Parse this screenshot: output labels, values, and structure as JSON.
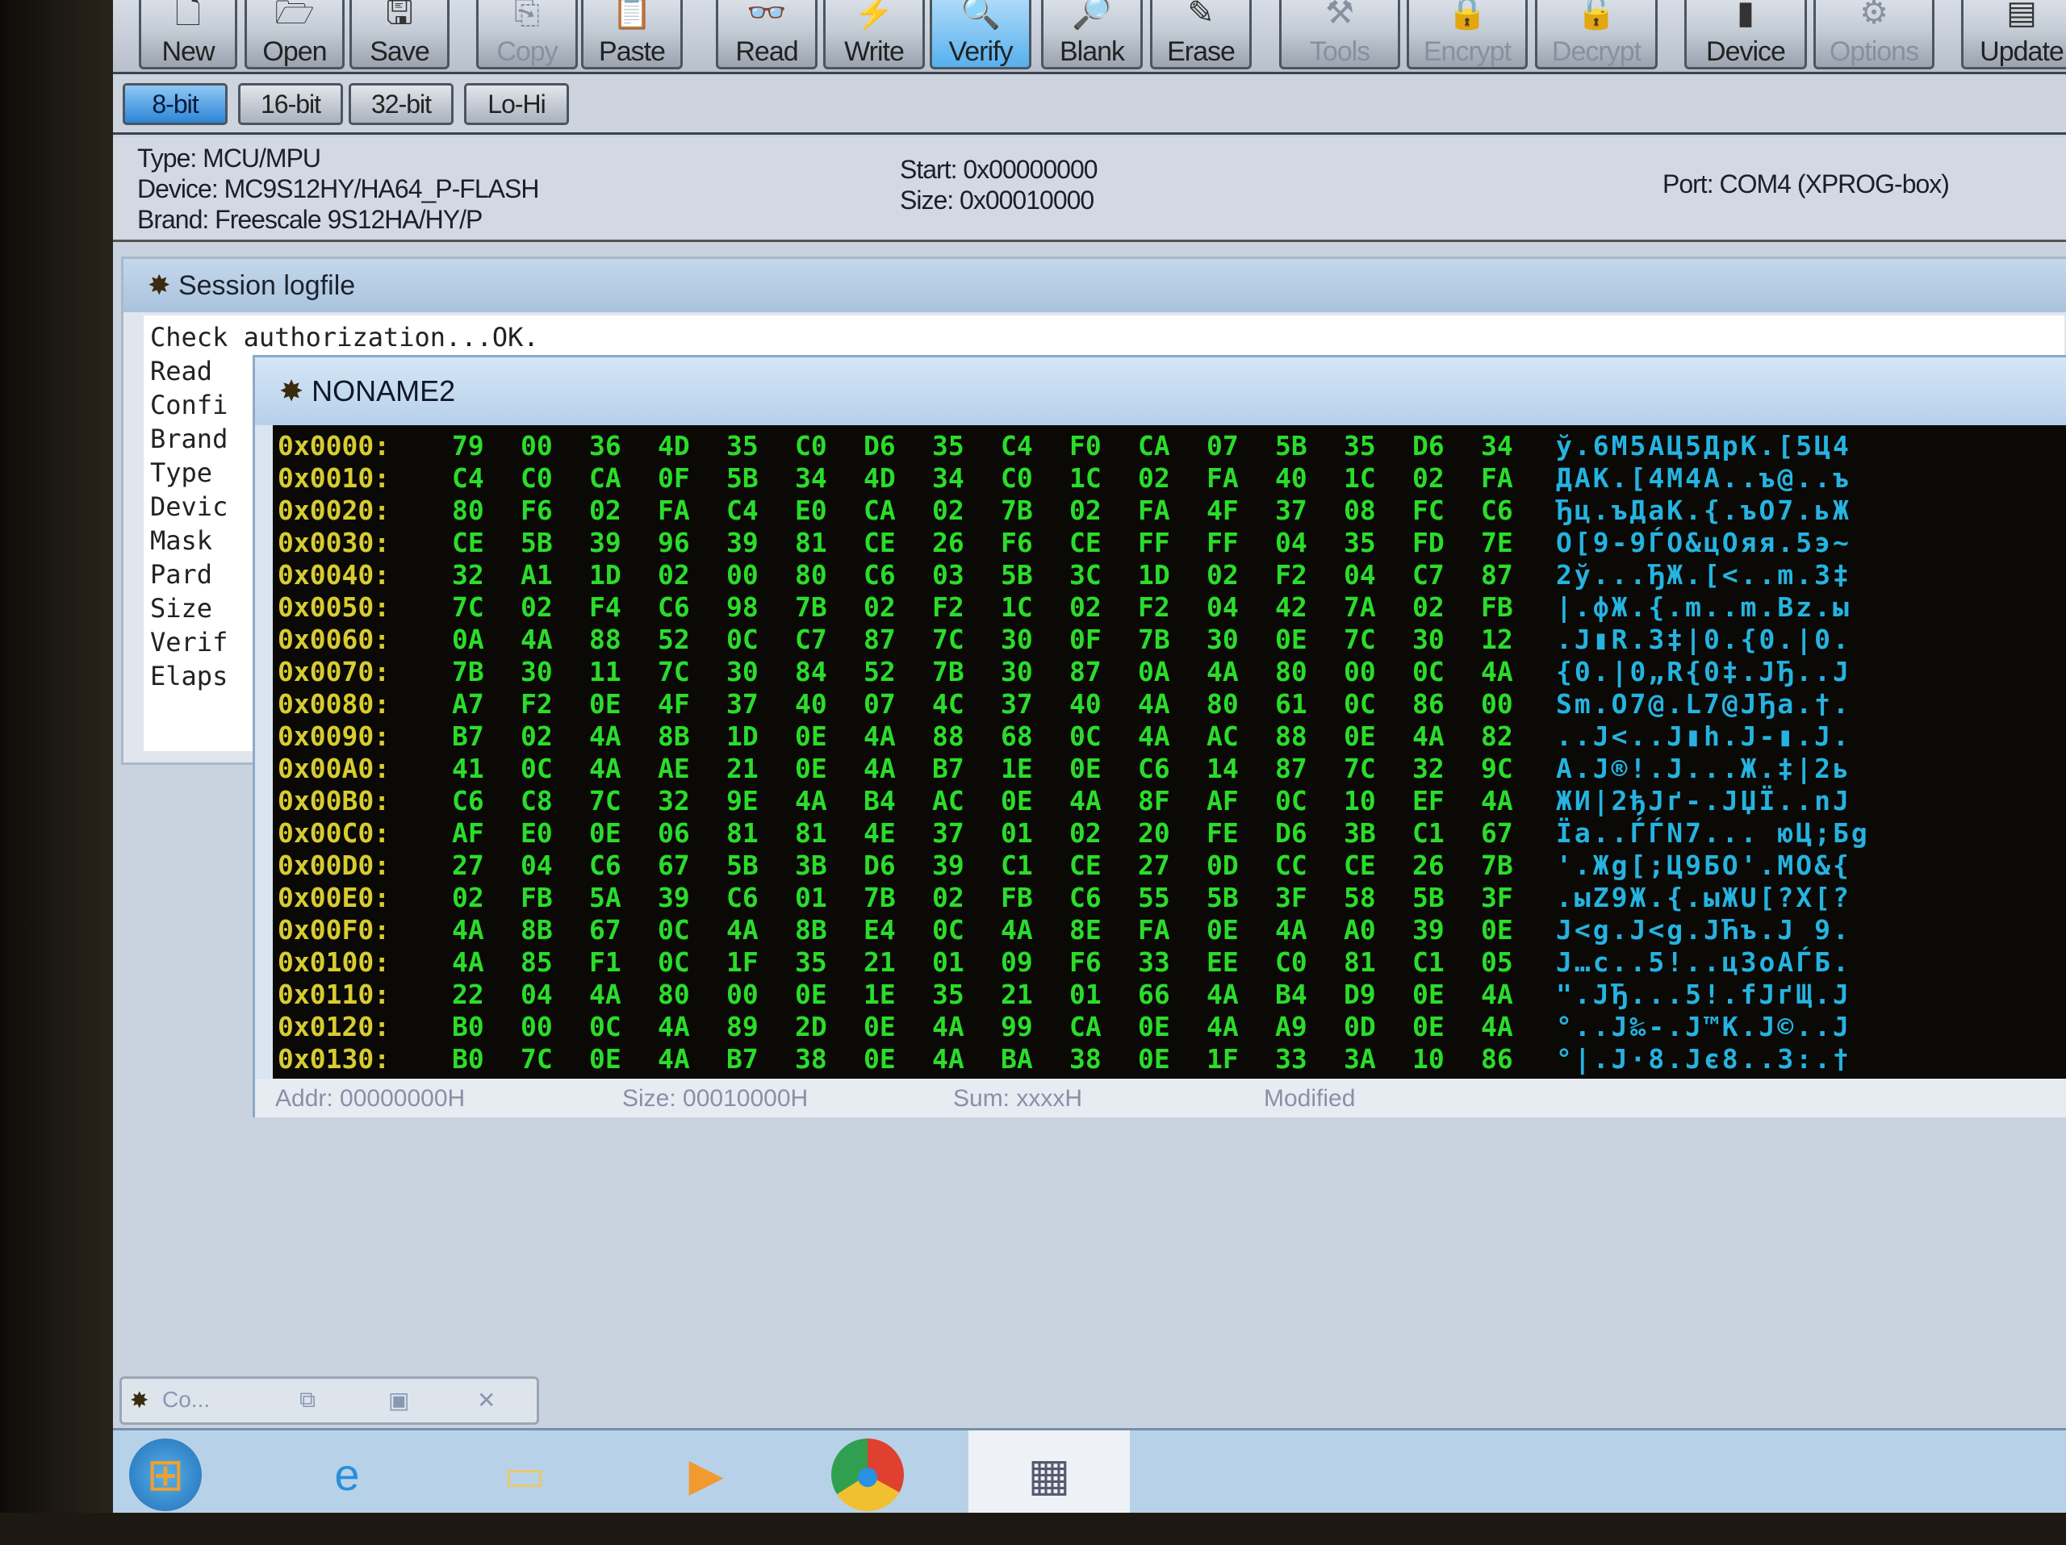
{
  "toolbar": {
    "buttons": [
      {
        "label": "New",
        "icon": "new-file-icon",
        "glyph": "🗋",
        "disabled": false
      },
      {
        "label": "Open",
        "icon": "open-icon",
        "glyph": "🗁",
        "disabled": false
      },
      {
        "label": "Save",
        "icon": "save-icon",
        "glyph": "🖫",
        "disabled": false
      },
      {
        "label": "Copy",
        "icon": "copy-icon",
        "glyph": "⎘",
        "disabled": true
      },
      {
        "label": "Paste",
        "icon": "paste-icon",
        "glyph": "📋",
        "disabled": false
      },
      {
        "label": "Read",
        "icon": "glasses-icon",
        "glyph": "👓",
        "disabled": false
      },
      {
        "label": "Write",
        "icon": "lightning-icon",
        "glyph": "⚡",
        "disabled": false
      },
      {
        "label": "Verify",
        "icon": "magnifier-icon",
        "glyph": "🔍",
        "disabled": false,
        "active": true
      },
      {
        "label": "Blank",
        "icon": "blank-check-icon",
        "glyph": "🔎",
        "disabled": false
      },
      {
        "label": "Erase",
        "icon": "eraser-icon",
        "glyph": "✎",
        "disabled": false
      },
      {
        "label": "Tools",
        "icon": "tools-icon",
        "glyph": "⚒",
        "disabled": true
      },
      {
        "label": "Encrypt",
        "icon": "lock-icon",
        "glyph": "🔒",
        "disabled": true
      },
      {
        "label": "Decrypt",
        "icon": "unlock-icon",
        "glyph": "🔓",
        "disabled": true
      },
      {
        "label": "Device",
        "icon": "chip-icon",
        "glyph": "▮",
        "disabled": false
      },
      {
        "label": "Options",
        "icon": "options-icon",
        "glyph": "⚙",
        "disabled": true
      },
      {
        "label": "Update",
        "icon": "update-icon",
        "glyph": "▤",
        "disabled": false
      }
    ]
  },
  "bitmode": {
    "buttons": [
      "8-bit",
      "16-bit",
      "32-bit",
      "Lo-Hi"
    ],
    "selected": "8-bit"
  },
  "info": {
    "type": "Type: MCU/MPU",
    "device": "Device: MC9S12HY/HA64_P-FLASH",
    "brand": "Brand: Freescale 9S12HA/HY/P",
    "start": "Start: 0x00000000",
    "size": "Size: 0x00010000",
    "port": "Port: COM4 (XPROG-box)"
  },
  "log": {
    "title": "Session logfile",
    "lines": [
      "Check authorization...OK.",
      "Read",
      "Confi",
      "Brand",
      "Type",
      "Devic",
      "Mask",
      "Pard",
      "Size",
      "Verif",
      "Elaps"
    ]
  },
  "hexwin": {
    "title": "NONAME2",
    "rows": [
      {
        "addr": "0x0000:",
        "bytes": [
          "79",
          "00",
          "36",
          "4D",
          "35",
          "C0",
          "D6",
          "35",
          "C4",
          "F0",
          "CA",
          "07",
          "5B",
          "35",
          "D6",
          "34"
        ],
        "ascii": "ў.6M5AЦ5ДрK.[5Ц4"
      },
      {
        "addr": "0x0010:",
        "bytes": [
          "C4",
          "C0",
          "CA",
          "0F",
          "5B",
          "34",
          "4D",
          "34",
          "C0",
          "1C",
          "02",
          "FA",
          "40",
          "1C",
          "02",
          "FA"
        ],
        "ascii": "ДAK.[4M4A..ъ@..ъ"
      },
      {
        "addr": "0x0020:",
        "bytes": [
          "80",
          "F6",
          "02",
          "FA",
          "C4",
          "E0",
          "CA",
          "02",
          "7B",
          "02",
          "FA",
          "4F",
          "37",
          "08",
          "FC",
          "C6"
        ],
        "ascii": "Ђц.ъДaK.{.ъO7.ьЖ"
      },
      {
        "addr": "0x0030:",
        "bytes": [
          "CE",
          "5B",
          "39",
          "96",
          "39",
          "81",
          "CE",
          "26",
          "F6",
          "CE",
          "FF",
          "FF",
          "04",
          "35",
          "FD",
          "7E"
        ],
        "ascii": "O[9-9ЃO&цOяя.5э~"
      },
      {
        "addr": "0x0040:",
        "bytes": [
          "32",
          "A1",
          "1D",
          "02",
          "00",
          "80",
          "C6",
          "03",
          "5B",
          "3C",
          "1D",
          "02",
          "F2",
          "04",
          "C7",
          "87"
        ],
        "ascii": "2ў...ЂЖ.[<..m.3‡"
      },
      {
        "addr": "0x0050:",
        "bytes": [
          "7C",
          "02",
          "F4",
          "C6",
          "98",
          "7B",
          "02",
          "F2",
          "1C",
          "02",
          "F2",
          "04",
          "42",
          "7A",
          "02",
          "FB"
        ],
        "ascii": "|.фЖ.{.m..m.Bz.ы"
      },
      {
        "addr": "0x0060:",
        "bytes": [
          "0A",
          "4A",
          "88",
          "52",
          "0C",
          "C7",
          "87",
          "7C",
          "30",
          "0F",
          "7B",
          "30",
          "0E",
          "7C",
          "30",
          "12"
        ],
        "ascii": ".J▮R.3‡|0.{0.|0."
      },
      {
        "addr": "0x0070:",
        "bytes": [
          "7B",
          "30",
          "11",
          "7C",
          "30",
          "84",
          "52",
          "7B",
          "30",
          "87",
          "0A",
          "4A",
          "80",
          "00",
          "0C",
          "4A"
        ],
        "ascii": "{0.|0„R{0‡.JЂ..J"
      },
      {
        "addr": "0x0080:",
        "bytes": [
          "A7",
          "F2",
          "0E",
          "4F",
          "37",
          "40",
          "07",
          "4C",
          "37",
          "40",
          "4A",
          "80",
          "61",
          "0C",
          "86",
          "00"
        ],
        "ascii": "Sm.O7@.L7@JЂa.†."
      },
      {
        "addr": "0x0090:",
        "bytes": [
          "B7",
          "02",
          "4A",
          "8B",
          "1D",
          "0E",
          "4A",
          "88",
          "68",
          "0C",
          "4A",
          "AC",
          "88",
          "0E",
          "4A",
          "82"
        ],
        "ascii": "..J<..J▮h.J-▮.J."
      },
      {
        "addr": "0x00A0:",
        "bytes": [
          "41",
          "0C",
          "4A",
          "AE",
          "21",
          "0E",
          "4A",
          "B7",
          "1E",
          "0E",
          "C6",
          "14",
          "87",
          "7C",
          "32",
          "9C"
        ],
        "ascii": "A.J®!.J...Ж.‡|2ь"
      },
      {
        "addr": "0x00B0:",
        "bytes": [
          "C6",
          "C8",
          "7C",
          "32",
          "9E",
          "4A",
          "B4",
          "AC",
          "0E",
          "4A",
          "8F",
          "AF",
          "0C",
          "10",
          "EF",
          "4A"
        ],
        "ascii": "ЖИ|2ђJґ-.JЏЇ..nJ"
      },
      {
        "addr": "0x00C0:",
        "bytes": [
          "AF",
          "E0",
          "0E",
          "06",
          "81",
          "81",
          "4E",
          "37",
          "01",
          "02",
          "20",
          "FE",
          "D6",
          "3B",
          "C1",
          "67"
        ],
        "ascii": "Їa..ЃЃN7... юЦ;Бg"
      },
      {
        "addr": "0x00D0:",
        "bytes": [
          "27",
          "04",
          "C6",
          "67",
          "5B",
          "3B",
          "D6",
          "39",
          "C1",
          "CE",
          "27",
          "0D",
          "CC",
          "CE",
          "26",
          "7B"
        ],
        "ascii": "'.Жg[;Ц9БO'.MO&{"
      },
      {
        "addr": "0x00E0:",
        "bytes": [
          "02",
          "FB",
          "5A",
          "39",
          "C6",
          "01",
          "7B",
          "02",
          "FB",
          "C6",
          "55",
          "5B",
          "3F",
          "58",
          "5B",
          "3F"
        ],
        "ascii": ".ыZ9Ж.{.ыЖU[?X[?"
      },
      {
        "addr": "0x00F0:",
        "bytes": [
          "4A",
          "8B",
          "67",
          "0C",
          "4A",
          "8B",
          "E4",
          "0C",
          "4A",
          "8E",
          "FA",
          "0E",
          "4A",
          "A0",
          "39",
          "0E"
        ],
        "ascii": "J<g.J<g.JЋъ.J 9."
      },
      {
        "addr": "0x0100:",
        "bytes": [
          "4A",
          "85",
          "F1",
          "0C",
          "1F",
          "35",
          "21",
          "01",
          "09",
          "F6",
          "33",
          "EE",
          "C0",
          "81",
          "C1",
          "05"
        ],
        "ascii": "J…c..5!..ц3oAЃБ."
      },
      {
        "addr": "0x0110:",
        "bytes": [
          "22",
          "04",
          "4A",
          "80",
          "00",
          "0E",
          "1E",
          "35",
          "21",
          "01",
          "66",
          "4A",
          "B4",
          "D9",
          "0E",
          "4A"
        ],
        "ascii": "\".JЂ...5!.fJґЩ.J"
      },
      {
        "addr": "0x0120:",
        "bytes": [
          "B0",
          "00",
          "0C",
          "4A",
          "89",
          "2D",
          "0E",
          "4A",
          "99",
          "CA",
          "0E",
          "4A",
          "A9",
          "0D",
          "0E",
          "4A"
        ],
        "ascii": "°..J‰-.J™K.J©..J"
      },
      {
        "addr": "0x0130:",
        "bytes": [
          "B0",
          "7C",
          "0E",
          "4A",
          "B7",
          "38",
          "0E",
          "4A",
          "BA",
          "38",
          "0E",
          "1F",
          "33",
          "3A",
          "10",
          "86"
        ],
        "ascii": "°|.J·8.Jє8..3:.†"
      }
    ],
    "status": {
      "addr": "Addr: 00000000H",
      "size": "Size: 00010000H",
      "sum": "Sum: xxxxH",
      "modified": "Modified"
    }
  },
  "minimized": {
    "label": "Co..."
  },
  "taskbar": {
    "items": [
      "start-orb-icon",
      "internet-explorer-icon",
      "file-explorer-icon",
      "media-player-icon",
      "chrome-icon",
      "xprog-chip-icon"
    ]
  },
  "colors": {
    "hex_bytes": "#2bdc2b",
    "hex_address": "#d8cc30",
    "hex_ascii": "#25b3e0",
    "selected_button": "#57b0ee"
  }
}
